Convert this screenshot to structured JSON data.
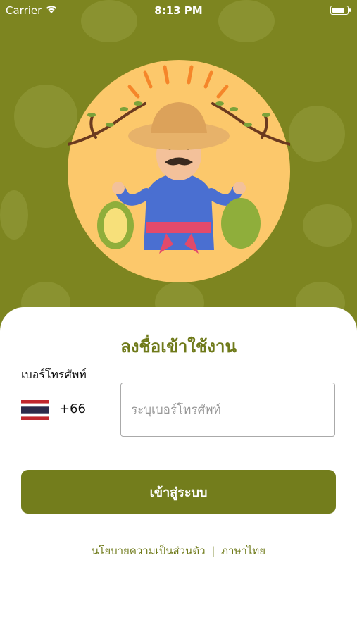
{
  "status_bar": {
    "carrier": "Carrier",
    "time": "8:13 PM"
  },
  "login": {
    "title": "ลงชื่อเข้าใช้งาน",
    "phone_label": "เบอร์โทรศัพท์",
    "country_code": "+66",
    "phone_placeholder": "ระบุเบอร์โทรศัพท์",
    "phone_value": "",
    "submit_label": "เข้าสู่ระบบ"
  },
  "footer": {
    "privacy_policy": "นโยบายความเป็นส่วนตัว",
    "separator": "|",
    "language": "ภาษาไทย"
  },
  "colors": {
    "brand_green": "#737d1c",
    "background_green": "#7d8520",
    "illustration_circle": "#fcc86b"
  },
  "icons": {
    "wifi": "wifi-icon",
    "battery": "battery-icon",
    "flag": "thailand-flag-icon"
  }
}
